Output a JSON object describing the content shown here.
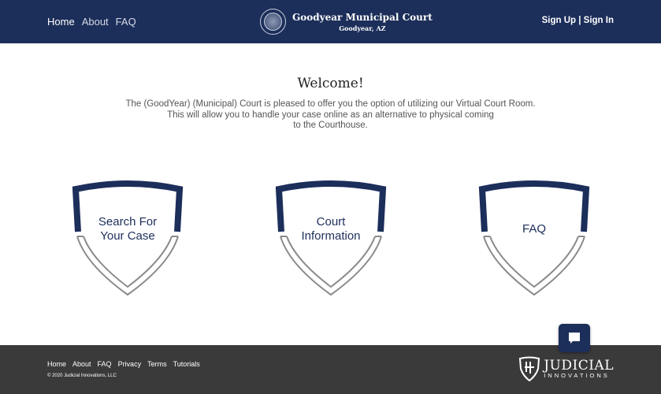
{
  "header": {
    "nav": [
      "Home",
      "About",
      "FAQ"
    ],
    "title": "Goodyear Municipal Court",
    "subtitle": "Goodyear, AZ",
    "sign_up": "Sign Up",
    "separator": " | ",
    "sign_in": "Sign In"
  },
  "main": {
    "welcome": "Welcome!",
    "intro": [
      "The (GoodYear) (Municipal) Court is pleased to offer you the option of utilizing our Virtual Court Room.",
      "This will allow you to handle your case online as an alternative to physical coming",
      "to the Courthouse."
    ],
    "cards": [
      {
        "line1": "Search For",
        "line2": "Your Case"
      },
      {
        "line1": "Court",
        "line2": "Information"
      },
      {
        "line1": "FAQ",
        "line2": ""
      }
    ]
  },
  "footer": {
    "links": [
      "Home",
      "About",
      "FAQ",
      "Privacy",
      "Terms",
      "Tutorials"
    ],
    "copyright": "© 2020 Judicial Innovations, LLC",
    "logo_line1": "JUDICIAL",
    "logo_line2": "INNOVATIONS"
  },
  "colors": {
    "navy": "#1c2e5a",
    "footer": "#3a3a3a",
    "shield_gray": "#8a8a8a"
  }
}
